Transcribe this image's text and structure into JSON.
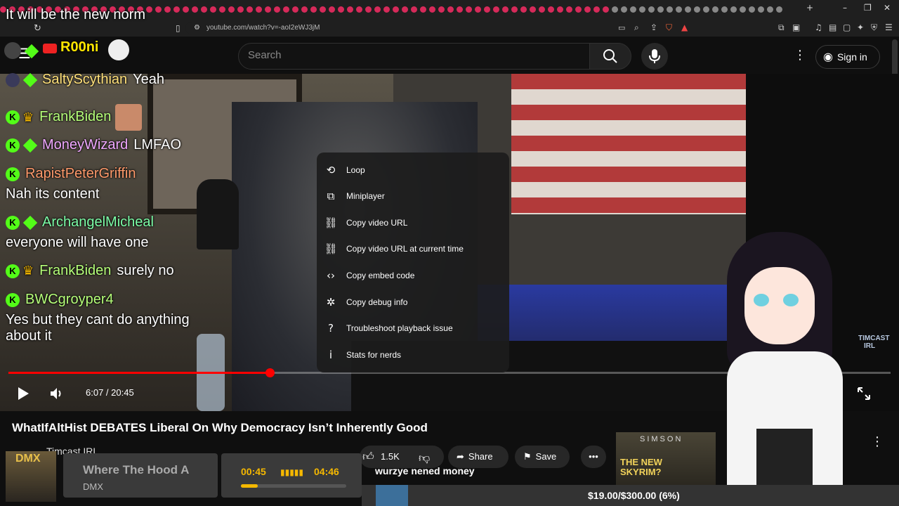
{
  "browser": {
    "url": "youtube.com/watch?v=-aoI2eWJ3jM",
    "overlay_chat_top": "It will be the new norm"
  },
  "youtube": {
    "search_placeholder": "Search",
    "sign_in": "Sign in"
  },
  "stream_overlay": {
    "streamer_name": "R00ni",
    "messages": [
      {
        "user": "SaltyScythian",
        "text": "Yeah",
        "user_color": "#ffe07a",
        "badge": "diamond"
      },
      {
        "user": "FrankBiden",
        "text": "",
        "user_color": "#b6ff7a",
        "badge": "crown"
      },
      {
        "user": "MoneyWizard",
        "text": "LMFAO",
        "user_color": "#f0a8ff",
        "badge": "diamond"
      },
      {
        "user": "RapistPeterGriffin",
        "text": "Nah its content",
        "user_color": "#ff9a6b",
        "badge": "none"
      },
      {
        "user": "ArchangelMicheal",
        "text": "everyone will have one",
        "user_color": "#7dffa8",
        "badge": "diamond"
      },
      {
        "user": "FrankBiden",
        "text": "surely no",
        "user_color": "#b6ff7a",
        "badge": "crown"
      },
      {
        "user": "BWCgroyper4",
        "text": "Yes but they cant do anything about it",
        "user_color": "#b6ff7a",
        "badge": "none"
      }
    ]
  },
  "player": {
    "time": "6:07 / 20:45",
    "progress_fraction": 0.296,
    "watermark": "TIMCAST IRL"
  },
  "context_menu": {
    "items": [
      {
        "label": "Loop",
        "icon": "loop-icon",
        "glyph": "⟲"
      },
      {
        "label": "Miniplayer",
        "icon": "miniplayer-icon",
        "glyph": "⧉"
      },
      {
        "label": "Copy video URL",
        "icon": "link-icon",
        "glyph": "⛓"
      },
      {
        "label": "Copy video URL at current time",
        "icon": "link-icon",
        "glyph": "⛓"
      },
      {
        "label": "Copy embed code",
        "icon": "code-icon",
        "glyph": "‹›"
      },
      {
        "label": "Copy debug info",
        "icon": "bug-icon",
        "glyph": "✲"
      },
      {
        "label": "Troubleshoot playback issue",
        "icon": "help-icon",
        "glyph": "?"
      },
      {
        "label": "Stats for nerds",
        "icon": "info-icon",
        "glyph": "i"
      }
    ]
  },
  "video_info": {
    "title": "WhatIfAltHist DEBATES Liberal On Why Democracy Isn’t Inherently Good",
    "channel": "Timcast IRL",
    "likes": "1.5K",
    "share": "Share",
    "save": "Save",
    "more": "•••"
  },
  "recommended": {
    "thumb_text_top": "SIMSON",
    "thumb_text": "THE NEW SKYRIM?"
  },
  "music_widget": {
    "song": "Where The Hood A",
    "artist": "DMX",
    "album_label": "DMX",
    "elapsed": "00:45",
    "total": "04:46",
    "progress_fraction": 0.16
  },
  "bottom_bar": {
    "ticker": "wurzye nened money",
    "goal": "$19.00/$300.00 (6%)"
  }
}
